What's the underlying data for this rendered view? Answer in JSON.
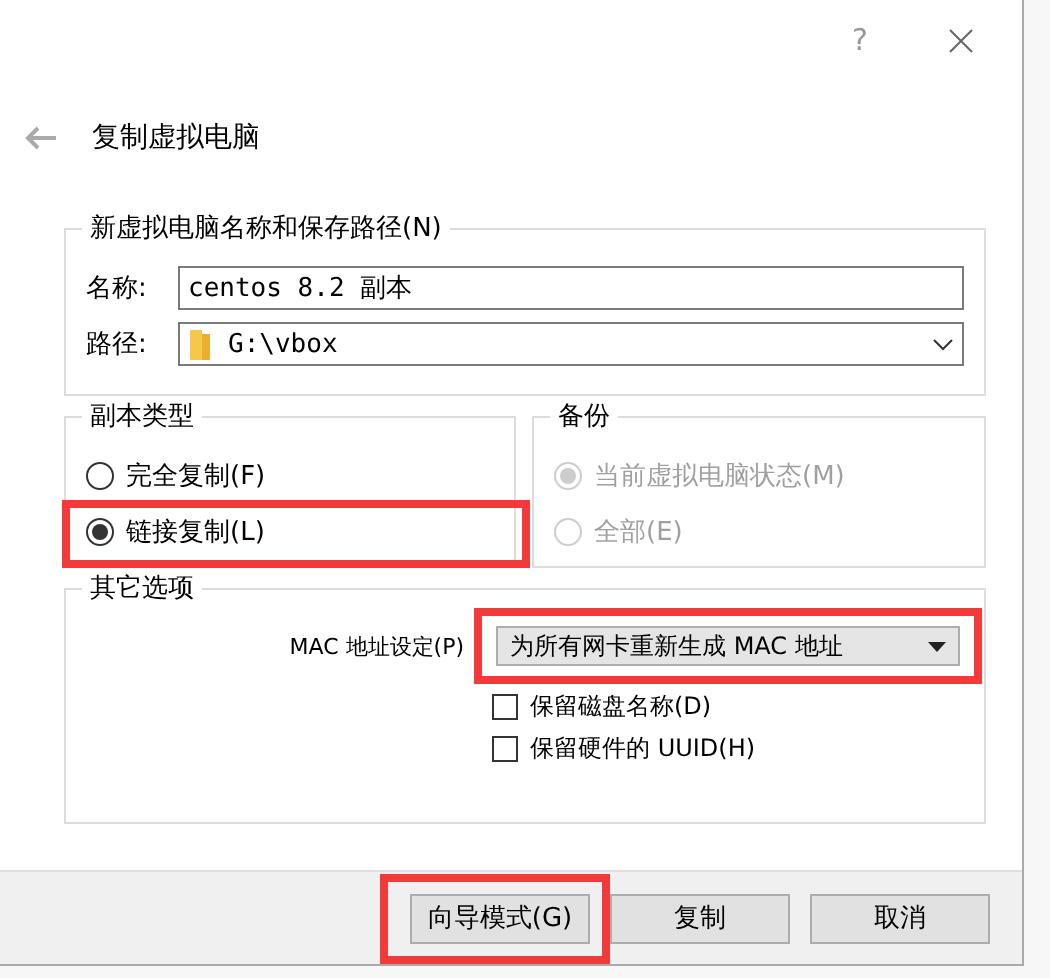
{
  "window": {
    "help": "?",
    "back_title": "复制虚拟电脑"
  },
  "name_group": {
    "legend": "新虚拟电脑名称和保存路径(N)",
    "name_label": "名称:",
    "name_value": "centos 8.2 副本",
    "path_label": "路径:",
    "path_value": "G:\\vbox"
  },
  "clone_type": {
    "legend": "副本类型",
    "options": [
      {
        "label": "完全复制(F)",
        "selected": false,
        "disabled": false,
        "highlighted": false
      },
      {
        "label": "链接复制(L)",
        "selected": true,
        "disabled": false,
        "highlighted": true
      }
    ]
  },
  "snapshots": {
    "legend": "备份",
    "options": [
      {
        "label": "当前虚拟电脑状态(M)",
        "selected": true,
        "disabled": true,
        "highlighted": false
      },
      {
        "label": "全部(E)",
        "selected": false,
        "disabled": true,
        "highlighted": false
      }
    ]
  },
  "other": {
    "legend": "其它选项",
    "mac_label": "MAC 地址设定(P)",
    "mac_value": "为所有网卡重新生成 MAC 地址",
    "mac_highlighted": true,
    "checkboxes": [
      {
        "label": "保留磁盘名称(D)",
        "checked": false
      },
      {
        "label": "保留硬件的 UUID(H)",
        "checked": false
      }
    ]
  },
  "buttons": [
    {
      "label": "向导模式(G)",
      "highlighted": true
    },
    {
      "label": "复制",
      "highlighted": false
    },
    {
      "label": "取消",
      "highlighted": false
    }
  ]
}
